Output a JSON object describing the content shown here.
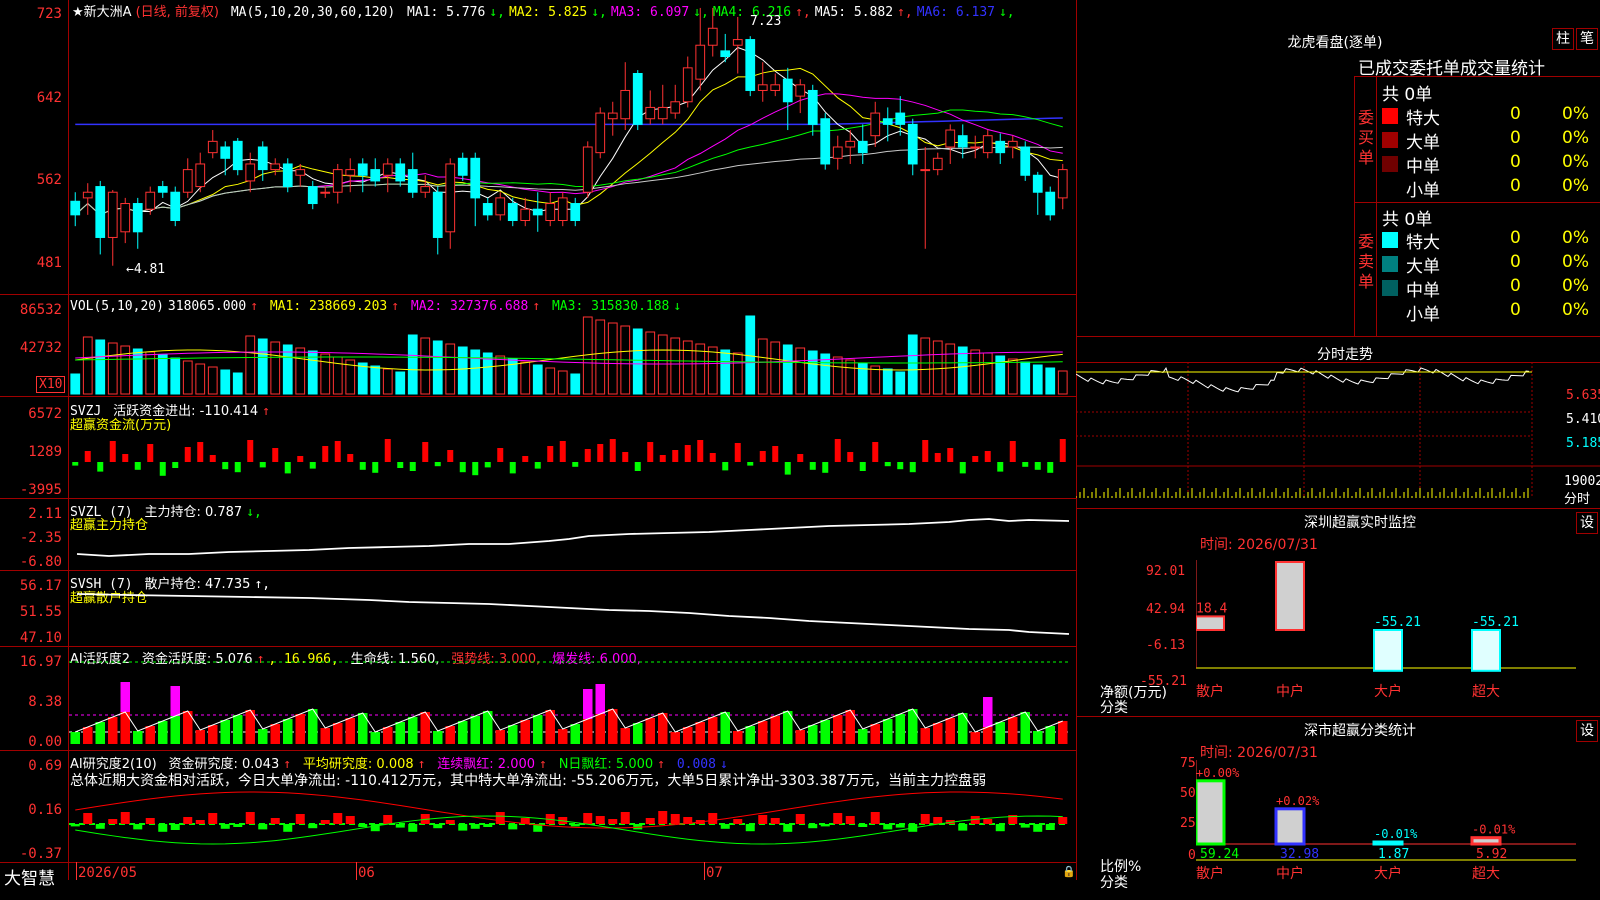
{
  "stock": {
    "title": "★新大洲A",
    "period": "(日线, 前复权)",
    "ma_header": "MA(5,10,20,30,60,120)",
    "ma_values": [
      {
        "label": "MA1:",
        "value": "5.776",
        "arrow": "↓",
        "color": "#ffffff"
      },
      {
        "label": "MA2:",
        "value": "5.825",
        "arrow": "↓",
        "color": "#ffff00"
      },
      {
        "label": "MA3:",
        "value": "6.097",
        "arrow": "↓",
        "color": "#ff00ff"
      },
      {
        "label": "MA4:",
        "value": "6.216",
        "arrow": "↑",
        "color": "#00ff00"
      },
      {
        "label": "MA5:",
        "value": "5.882",
        "arrow": "↑",
        "color": "#ffffff"
      },
      {
        "label": "MA6:",
        "value": "6.137",
        "arrow": "↓",
        "color": "#3232ff"
      }
    ],
    "price_axis": [
      "723",
      "642",
      "562",
      "481"
    ],
    "high_marker": "7.23",
    "low_marker": "←4.81"
  },
  "volume": {
    "header": "VOL(5,10,20)",
    "value": "318065.000",
    "value_arrow": "↑",
    "ma1": "MA1: 238669.203",
    "ma1_arrow": "↑",
    "ma2": "MA2: 327376.688",
    "ma2_arrow": "↑",
    "ma3": "MA3: 315830.188",
    "ma3_arrow": "↓",
    "axis": [
      "86532",
      "42732"
    ],
    "unit": "X10"
  },
  "svzj": {
    "header": "SVZJ",
    "label": "活跃资金进出: -110.414",
    "arrow": "↑",
    "subtitle": "超赢资金流(万元)",
    "axis": [
      "6572",
      "1289",
      "-3995"
    ]
  },
  "svzl": {
    "header": "SVZL (7)",
    "label": "主力持仓: 0.787",
    "arrow": "↓,",
    "subtitle": "超赢主力持仓",
    "axis": [
      "2.11",
      "-2.35",
      "-6.80"
    ]
  },
  "svsh": {
    "header": "SVSH (7)",
    "label": "散户持仓: 47.735",
    "arrow": "↑,",
    "subtitle": "超赢散户持仓",
    "axis": [
      "56.17",
      "51.55",
      "47.10"
    ]
  },
  "ai_active": {
    "header": "AI活跃度2",
    "label": "资金活跃度: 5.076",
    "arrow": "↑",
    "extra": ", 16.966,",
    "life": "生命线: 1.560,",
    "strong": "强势线: 3.000,",
    "burst": "爆发线: 6.000,",
    "axis": [
      "16.97",
      "8.38",
      "0.00"
    ]
  },
  "ai_research": {
    "header": "AI研究度2(10)",
    "label": "资金研究度: 0.043",
    "arrow": "↑",
    "avg": "平均研究度: 0.008",
    "avg_arrow": "↑",
    "cont": "连续飘红: 2.000",
    "cont_arrow": "↑",
    "nday": "N日飘红: 5.000",
    "nday_arrow": "↑",
    "last": "0.008",
    "last_arrow": "↓",
    "summary": "总体近期大资金相对活跃，今日大单净流出: -110.412万元，其中特大单净流出: -55.206万元，大单5日累计净出-3303.387万元，当前主力控盘弱",
    "axis": [
      "0.69",
      "0.16",
      "-0.37"
    ]
  },
  "xaxis": {
    "brand": "大智慧",
    "labels": [
      "2026/05",
      "06",
      "07"
    ]
  },
  "right": {
    "lhb_title": "龙虎看盘(逐单)",
    "btn1": "柱",
    "btn2": "笔",
    "lhb_header": "已成交委托单成交量统计",
    "buy_label": "委买单",
    "sell_label": "委卖单",
    "buy_total": "共 0单",
    "sell_total": "共 0单",
    "buy_rows": [
      {
        "name": "特大",
        "count": "0",
        "pct": "0%",
        "color": "#ff0000"
      },
      {
        "name": "大单",
        "count": "0",
        "pct": "0%",
        "color": "#a00000"
      },
      {
        "name": "中单",
        "count": "0",
        "pct": "0%",
        "color": "#700000"
      },
      {
        "name": "小单",
        "count": "0",
        "pct": "0%",
        "color": "#000000"
      }
    ],
    "sell_rows": [
      {
        "name": "特大",
        "count": "0",
        "pct": "0%",
        "color": "#00ffff"
      },
      {
        "name": "大单",
        "count": "0",
        "pct": "0%",
        "color": "#008080"
      },
      {
        "name": "中单",
        "count": "0",
        "pct": "0%",
        "color": "#006060"
      },
      {
        "name": "小单",
        "count": "0",
        "pct": "0%",
        "color": "#000000"
      }
    ],
    "fenshi_title": "分时走势",
    "fenshi_axis": [
      "5.635",
      "5.410",
      "5.185"
    ],
    "fenshi_vol": "19002",
    "fenshi_unit": "分时",
    "sz_title": "深圳超赢实时监控",
    "sz_btn": "设",
    "sz_time": "时间: 2026/07/31",
    "sz_axis": [
      "92.01",
      "42.94",
      "-6.13",
      "-55.21"
    ],
    "sz_ylabel": "净额(万元)",
    "sz_xlabel": "分类",
    "sz_cats": [
      "散户",
      "中户",
      "大户",
      "超大"
    ],
    "sz_values": [
      "18.4",
      "92.01",
      "-55.21",
      "-55.21"
    ],
    "fl_title": "深市超赢分类统计",
    "fl_btn": "设",
    "fl_time": "时间: 2026/07/31",
    "fl_axis": [
      "75",
      "50",
      "25",
      "0"
    ],
    "fl_ylabel": "比例%",
    "fl_xlabel": "分类",
    "fl_cats": [
      "散户",
      "中户",
      "大户",
      "超大"
    ],
    "fl_values": [
      "59.24",
      "32.98",
      "1.87",
      "5.92"
    ],
    "fl_changes": [
      "+0.00%",
      "+0.02%",
      "-0.01%",
      "-0.01%"
    ]
  },
  "colors": {
    "up": "#ff3232",
    "down": "#00ffff",
    "grid": "#a00000",
    "ma1": "#ffffff",
    "ma2": "#ffff00",
    "ma3": "#ff00ff",
    "ma4": "#00ff00",
    "ma6": "#3232ff"
  },
  "chart_data": {
    "type": "candlestick",
    "candles": [
      {
        "o": 552,
        "c": 540,
        "h": 560,
        "l": 530
      },
      {
        "o": 555,
        "c": 560,
        "h": 568,
        "l": 540
      },
      {
        "o": 565,
        "c": 520,
        "h": 570,
        "l": 505
      },
      {
        "o": 520,
        "c": 560,
        "h": 562,
        "l": 495
      },
      {
        "o": 525,
        "c": 550,
        "h": 555,
        "l": 515
      },
      {
        "o": 550,
        "c": 525,
        "h": 555,
        "l": 510
      },
      {
        "o": 545,
        "c": 560,
        "h": 565,
        "l": 540
      },
      {
        "o": 565,
        "c": 560,
        "h": 570,
        "l": 555
      },
      {
        "o": 560,
        "c": 535,
        "h": 565,
        "l": 530
      },
      {
        "o": 560,
        "c": 580,
        "h": 590,
        "l": 555
      },
      {
        "o": 565,
        "c": 585,
        "h": 595,
        "l": 560
      },
      {
        "o": 595,
        "c": 605,
        "h": 615,
        "l": 590
      },
      {
        "o": 600,
        "c": 590,
        "h": 605,
        "l": 575
      },
      {
        "o": 605,
        "c": 580,
        "h": 608,
        "l": 575
      },
      {
        "o": 570,
        "c": 585,
        "h": 595,
        "l": 560
      },
      {
        "o": 600,
        "c": 580,
        "h": 605,
        "l": 570
      },
      {
        "o": 580,
        "c": 585,
        "h": 590,
        "l": 575
      },
      {
        "o": 585,
        "c": 565,
        "h": 590,
        "l": 560
      },
      {
        "o": 575,
        "c": 580,
        "h": 585,
        "l": 565
      },
      {
        "o": 565,
        "c": 550,
        "h": 570,
        "l": 545
      },
      {
        "o": 560,
        "c": 560,
        "h": 565,
        "l": 555
      },
      {
        "o": 560,
        "c": 580,
        "h": 585,
        "l": 550
      },
      {
        "o": 575,
        "c": 580,
        "h": 590,
        "l": 560
      },
      {
        "o": 585,
        "c": 575,
        "h": 590,
        "l": 560
      },
      {
        "o": 580,
        "c": 570,
        "h": 590,
        "l": 565
      },
      {
        "o": 575,
        "c": 585,
        "h": 590,
        "l": 560
      },
      {
        "o": 585,
        "c": 570,
        "h": 590,
        "l": 565
      },
      {
        "o": 580,
        "c": 560,
        "h": 595,
        "l": 555
      },
      {
        "o": 560,
        "c": 565,
        "h": 575,
        "l": 555
      },
      {
        "o": 560,
        "c": 520,
        "h": 565,
        "l": 505
      },
      {
        "o": 525,
        "c": 585,
        "h": 590,
        "l": 510
      },
      {
        "o": 590,
        "c": 575,
        "h": 595,
        "l": 570
      },
      {
        "o": 590,
        "c": 555,
        "h": 595,
        "l": 530
      },
      {
        "o": 550,
        "c": 540,
        "h": 555,
        "l": 535
      },
      {
        "o": 540,
        "c": 555,
        "h": 560,
        "l": 535
      },
      {
        "o": 550,
        "c": 535,
        "h": 555,
        "l": 530
      },
      {
        "o": 535,
        "c": 545,
        "h": 555,
        "l": 530
      },
      {
        "o": 545,
        "c": 540,
        "h": 560,
        "l": 525
      },
      {
        "o": 535,
        "c": 550,
        "h": 560,
        "l": 530
      },
      {
        "o": 535,
        "c": 555,
        "h": 560,
        "l": 530
      },
      {
        "o": 550,
        "c": 535,
        "h": 555,
        "l": 530
      },
      {
        "o": 560,
        "c": 600,
        "h": 605,
        "l": 555
      },
      {
        "o": 595,
        "c": 630,
        "h": 635,
        "l": 590
      },
      {
        "o": 625,
        "c": 630,
        "h": 640,
        "l": 610
      },
      {
        "o": 625,
        "c": 650,
        "h": 675,
        "l": 615
      },
      {
        "o": 665,
        "c": 620,
        "h": 668,
        "l": 615
      },
      {
        "o": 625,
        "c": 635,
        "h": 650,
        "l": 620
      },
      {
        "o": 625,
        "c": 635,
        "h": 655,
        "l": 620
      },
      {
        "o": 630,
        "c": 640,
        "h": 655,
        "l": 625
      },
      {
        "o": 640,
        "c": 670,
        "h": 680,
        "l": 635
      },
      {
        "o": 660,
        "c": 690,
        "h": 723,
        "l": 650
      },
      {
        "o": 690,
        "c": 705,
        "h": 723,
        "l": 680
      },
      {
        "o": 685,
        "c": 680,
        "h": 700,
        "l": 675
      },
      {
        "o": 690,
        "c": 695,
        "h": 715,
        "l": 665
      },
      {
        "o": 695,
        "c": 650,
        "h": 698,
        "l": 645
      },
      {
        "o": 650,
        "c": 655,
        "h": 675,
        "l": 640
      },
      {
        "o": 650,
        "c": 655,
        "h": 665,
        "l": 645
      },
      {
        "o": 660,
        "c": 640,
        "h": 670,
        "l": 615
      },
      {
        "o": 645,
        "c": 655,
        "h": 660,
        "l": 630
      },
      {
        "o": 650,
        "c": 620,
        "h": 655,
        "l": 610
      },
      {
        "o": 625,
        "c": 585,
        "h": 630,
        "l": 580
      },
      {
        "o": 590,
        "c": 600,
        "h": 610,
        "l": 580
      },
      {
        "o": 600,
        "c": 605,
        "h": 615,
        "l": 585
      },
      {
        "o": 605,
        "c": 595,
        "h": 620,
        "l": 585
      },
      {
        "o": 610,
        "c": 630,
        "h": 640,
        "l": 600
      },
      {
        "o": 625,
        "c": 620,
        "h": 635,
        "l": 605
      },
      {
        "o": 630,
        "c": 620,
        "h": 645,
        "l": 610
      },
      {
        "o": 620,
        "c": 585,
        "h": 625,
        "l": 575
      },
      {
        "o": 580,
        "c": 580,
        "h": 600,
        "l": 510
      },
      {
        "o": 580,
        "c": 590,
        "h": 595,
        "l": 575
      },
      {
        "o": 600,
        "c": 615,
        "h": 620,
        "l": 585
      },
      {
        "o": 610,
        "c": 600,
        "h": 620,
        "l": 590
      },
      {
        "o": 600,
        "c": 600,
        "h": 610,
        "l": 590
      },
      {
        "o": 595,
        "c": 610,
        "h": 615,
        "l": 590
      },
      {
        "o": 605,
        "c": 595,
        "h": 612,
        "l": 585
      },
      {
        "o": 600,
        "c": 605,
        "h": 610,
        "l": 590
      },
      {
        "o": 600,
        "c": 575,
        "h": 605,
        "l": 570
      },
      {
        "o": 575,
        "c": 560,
        "h": 578,
        "l": 540
      },
      {
        "o": 560,
        "c": 540,
        "h": 565,
        "l": 535
      },
      {
        "o": 555,
        "c": 580,
        "h": 585,
        "l": 545
      }
    ],
    "price_range": [
      470,
      730
    ]
  }
}
